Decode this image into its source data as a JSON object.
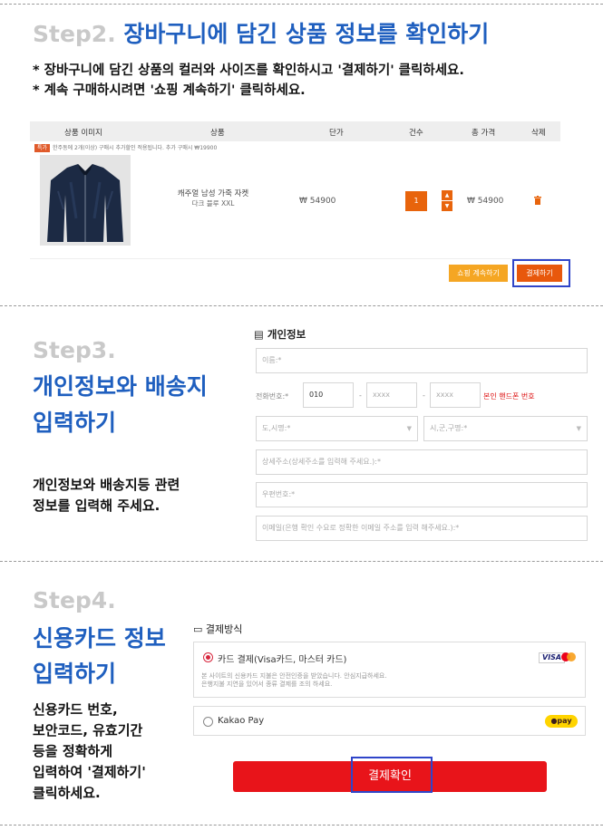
{
  "step2": {
    "num": "Step2.",
    "head": "장바구니에 담긴 상품 정보를 확인하기",
    "desc1": "* 장바구니에 담긴 상품의 컬러와 사이즈를 확인하시고 '결제하기' 클릭하세요.",
    "desc2": "* 계속 구매하시려면 '쇼핑 계속하기' 클릭하세요."
  },
  "cart": {
    "columns": [
      "상품 이미지",
      "상품",
      "단가",
      "건수",
      "총 가격",
      "삭제"
    ],
    "promo_tag": "특가",
    "promo_text": "한주동에 2개(이상) 구매시 추가할인 적용됩니다. 추가 구매시 ₩19900",
    "item": {
      "name": "캐주얼 남성 가죽 자켓",
      "option": "다크 블루 XXL",
      "unit_price": "₩ 54900",
      "qty": "1",
      "total": "₩ 54900"
    },
    "continue_label": "쇼핑 계속하기",
    "checkout_label": "결제하기"
  },
  "step3": {
    "num": "Step3.",
    "head1": "개인정보와 배송지",
    "head2": "입력하기",
    "desc1": "개인정보와 배송지등 관련",
    "desc2": "정보를 입력해 주세요.",
    "section_title": "개인정보",
    "name_placeholder": "이름:*",
    "phone_label": "전화번호:*",
    "phone_prefix": "010",
    "phone_mid": "xxxx",
    "phone_last": "xxxx",
    "dash": "-",
    "phone_note": "본인 핸드폰 번호",
    "province_placeholder": "도,시명:*",
    "city_placeholder": "시,군,구명:*",
    "address_placeholder": "상세주소(상세주소를 입력해 주세요.):*",
    "zip_placeholder": "우편번호:*",
    "email_placeholder": "이메일(은행 확인 수요로 정확한 이메일 주소를 입력 해주세요.):*"
  },
  "step4": {
    "num": "Step4.",
    "head1": "신용카드 정보",
    "head2": "입력하기",
    "desc": [
      "신용카드 번호,",
      "보안코드, 유효기간",
      "등을 정확하게",
      "입력하여 '결제하기'",
      "클릭하세요."
    ],
    "section_title": "결제방식",
    "card_label": "카드 결제(Visa카드, 마스터 카드)",
    "card_note1": "본 사이트의 신용카드 지불은 안전인증을 받았습니다. 안심지급하세요.",
    "card_note2": "은행지불 지연을 있어서 종류 결제를 조의 하세요.",
    "visa": "VISA",
    "kakao_label": "Kakao Pay",
    "kakao_badge": "●pay",
    "confirm_label": "결제확인"
  },
  "colors": {
    "accent": "#1f5fbf",
    "orange": "#e8640c",
    "confirm": "#e8141a",
    "highlight": "#2f45c9"
  }
}
